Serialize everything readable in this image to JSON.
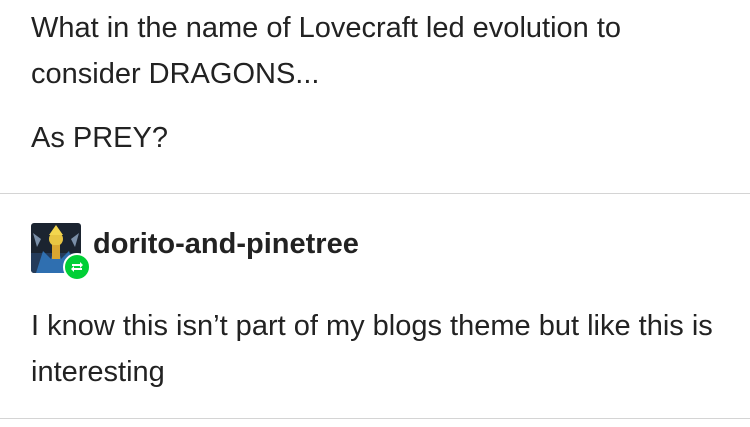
{
  "original_post": {
    "line1": "What in the name of Lovecraft led evolution to consider DRAGONS...",
    "line2": "As PREY?"
  },
  "reblog": {
    "username": "dorito-and-pinetree",
    "text": "I know this isn’t part of my blogs theme but like this is interesting",
    "avatar_icon": "avatar-image",
    "badge_icon": "reblog-icon",
    "badge_color": "#00cf35"
  }
}
